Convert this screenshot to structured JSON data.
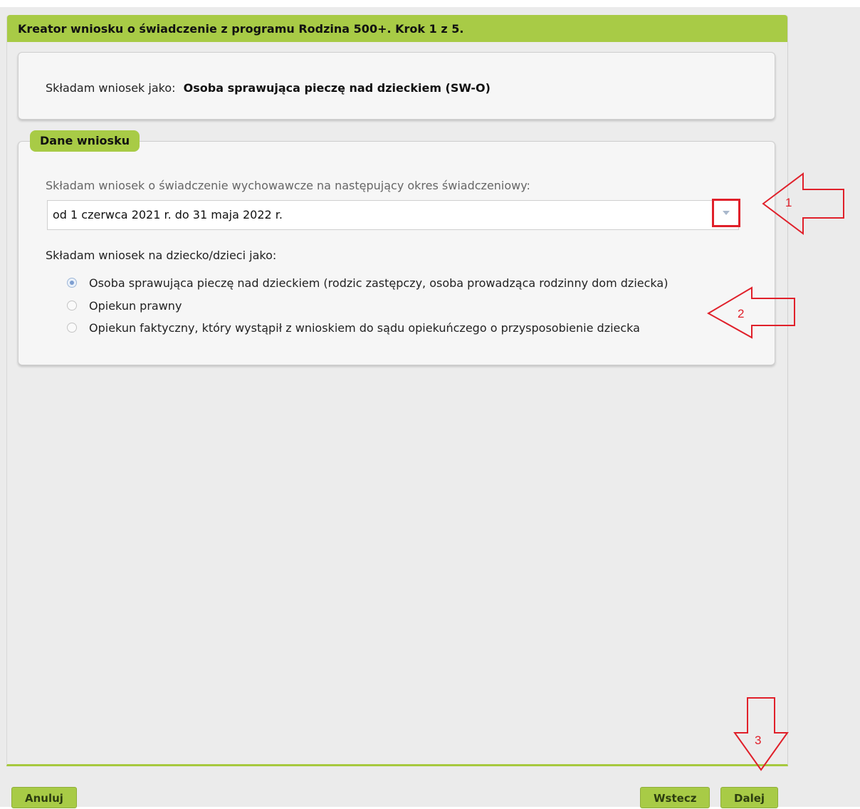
{
  "wizard": {
    "title": "Kreator wniosku o świadczenie z programu Rodzina 500+. Krok 1 z 5.",
    "accent_color": "#a8cb46"
  },
  "role_card": {
    "label": "Składam wniosek jako:",
    "value": "Osoba sprawująca pieczę nad dzieckiem (SW-O)"
  },
  "dane_wniosku": {
    "section_title": "Dane wniosku",
    "period_label": "Składam wniosek o świadczenie wychowawcze na następujący okres świadczeniowy:",
    "period_select": {
      "value": "od 1 czerwca 2021 r. do 31 maja 2022 r.",
      "arrow_icon": "chevron-down-icon"
    },
    "child_label": "Składam wniosek na dziecko/dzieci jako:",
    "radio_options": [
      {
        "label": "Osoba sprawująca pieczę nad dzieckiem (rodzic zastępczy, osoba prowadząca rodzinny dom dziecka)",
        "checked": true
      },
      {
        "label": "Opiekun prawny",
        "checked": false
      },
      {
        "label": "Opiekun faktyczny, który wystąpił z wnioskiem do sądu opiekuńczego o przysposobienie dziecka",
        "checked": false
      }
    ]
  },
  "buttons": {
    "cancel": "Anuluj",
    "back": "Wstecz",
    "next": "Dalej"
  },
  "annotations": {
    "color": "#e0202a",
    "arrow_1": "1",
    "arrow_2": "2",
    "arrow_3": "3"
  }
}
